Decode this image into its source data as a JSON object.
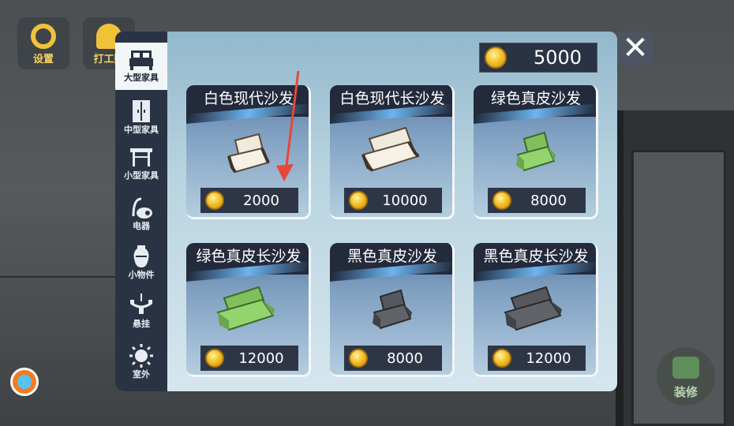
{
  "hud": {
    "settings_label": "设置",
    "work_label": "打工赚"
  },
  "decorate_label": "装修",
  "wallet": {
    "coins": "5000"
  },
  "close_symbol": "✕",
  "sidebar": {
    "categories": [
      {
        "label": "大型家具",
        "icon": "bed-icon",
        "active": true
      },
      {
        "label": "中型家具",
        "icon": "wardrobe-icon"
      },
      {
        "label": "小型家具",
        "icon": "table-icon"
      },
      {
        "label": "电器",
        "icon": "vacuum-icon"
      },
      {
        "label": "小物件",
        "icon": "vase-icon"
      },
      {
        "label": "悬挂",
        "icon": "chandelier-icon"
      },
      {
        "label": "室外",
        "icon": "sun-icon"
      }
    ]
  },
  "items": [
    {
      "name": "白色现代沙发",
      "price": "2000",
      "color": "#e8e2d2"
    },
    {
      "name": "白色现代长沙发",
      "price": "10000",
      "color": "#e8e2d2"
    },
    {
      "name": "绿色真皮沙发",
      "price": "8000",
      "color": "#8cc96a"
    },
    {
      "name": "绿色真皮长沙发",
      "price": "12000",
      "color": "#8cc96a"
    },
    {
      "name": "黑色真皮沙发",
      "price": "8000",
      "color": "#4a4c4f"
    },
    {
      "name": "黑色真皮长沙发",
      "price": "12000",
      "color": "#4a4c4f"
    }
  ],
  "colors": {
    "accent_coin": "#f5c22c",
    "panel_dark": "#2a3344",
    "annotation_arrow": "#e8463a"
  }
}
